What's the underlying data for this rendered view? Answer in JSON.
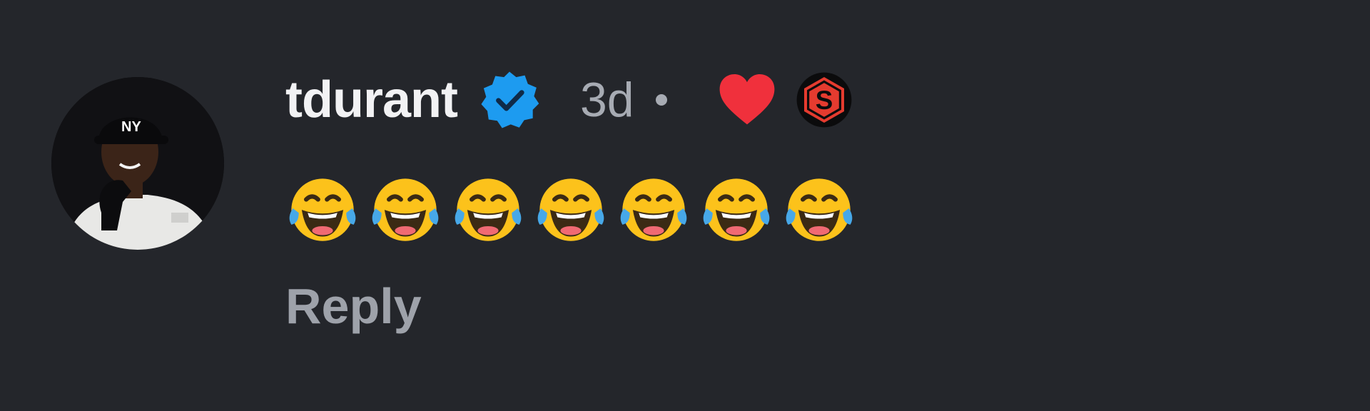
{
  "comment": {
    "username": "tdurant",
    "verified": true,
    "time_ago": "3d",
    "separator": "•",
    "liked_by_author_icon": "heart-icon",
    "badge_icon": "s-logo-badge-icon",
    "message_emoji": "face-with-tears-of-joy",
    "emoji_count": 7,
    "reply_label": "Reply"
  },
  "colors": {
    "background": "#24262b",
    "username": "#f2f2f4",
    "meta": "#a7abb3",
    "verified_blue": "#1d9bf0",
    "heart_red": "#f0303c",
    "badge_red": "#e53b2f"
  }
}
